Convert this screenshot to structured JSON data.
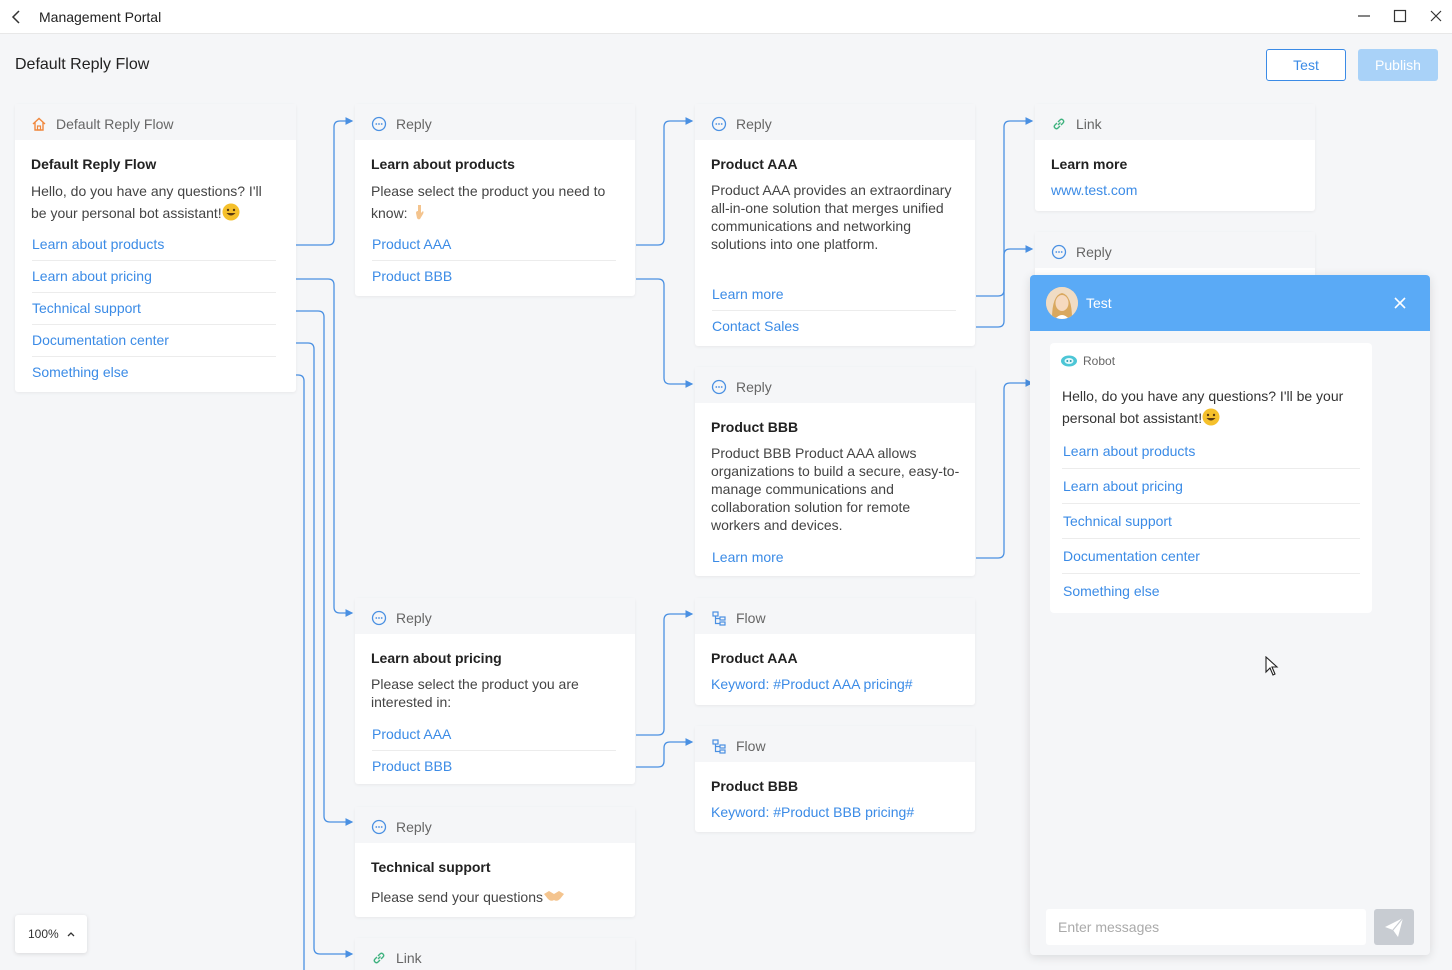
{
  "window": {
    "title": "Management Portal"
  },
  "header": {
    "title": "Default Reply Flow",
    "test_label": "Test",
    "publish_label": "Publish"
  },
  "nodes": {
    "root": {
      "head": "Default Reply Flow",
      "title": "Default Reply Flow",
      "text": "Hello, do you have any questions? I'll be your personal bot assistant!",
      "options": [
        "Learn about products",
        "Learn about pricing",
        "Technical support",
        "Documentation center",
        "Something else"
      ]
    },
    "reply_products": {
      "head": "Reply",
      "title": "Learn about products",
      "text": "Please select the product you need to know:",
      "options": [
        "Product AAA",
        "Product BBB"
      ]
    },
    "reply_aaa": {
      "head": "Reply",
      "title": "Product AAA",
      "text": "Product AAA provides an extraordinary all-in-one solution that merges unified communications and networking solutions into one platform.",
      "options": [
        "Learn more",
        "Contact Sales"
      ]
    },
    "link_learn": {
      "head": "Link",
      "title": "Learn more",
      "url": "www.test.com"
    },
    "reply_partial": {
      "head": "Reply"
    },
    "reply_bbb": {
      "head": "Reply",
      "title": "Product BBB",
      "text": "Product BBB Product AAA allows organizations to build a secure, easy-to-manage communications and collaboration solution for remote workers and devices.",
      "options": [
        "Learn more"
      ]
    },
    "reply_pricing": {
      "head": "Reply",
      "title": "Learn about pricing",
      "text": "Please select the product you are interested in:",
      "options": [
        "Product AAA",
        "Product BBB"
      ]
    },
    "flow_aaa": {
      "head": "Flow",
      "title": "Product AAA",
      "keyword": "Keyword: #Product AAA pricing#"
    },
    "flow_bbb": {
      "head": "Flow",
      "title": "Product BBB",
      "keyword": "Keyword: #Product BBB pricing#"
    },
    "reply_support": {
      "head": "Reply",
      "title": "Technical support",
      "text": "Please send your questions"
    },
    "link_bottom": {
      "head": "Link"
    }
  },
  "test_panel": {
    "title": "Test",
    "robot_label": "Robot",
    "message": "Hello, do you have any questions? I'll be your personal bot assistant!",
    "options": [
      "Learn about products",
      "Learn about pricing",
      "Technical support",
      "Documentation center",
      "Something else"
    ],
    "input_placeholder": "Enter messages"
  },
  "zoom": {
    "value": "100%"
  },
  "colors": {
    "accent": "#3b8be6",
    "panel_header": "#5aaaf6",
    "publish_disabled": "#a9d2f8",
    "wire": "#4a90e2",
    "home_icon": "#f0883e"
  }
}
